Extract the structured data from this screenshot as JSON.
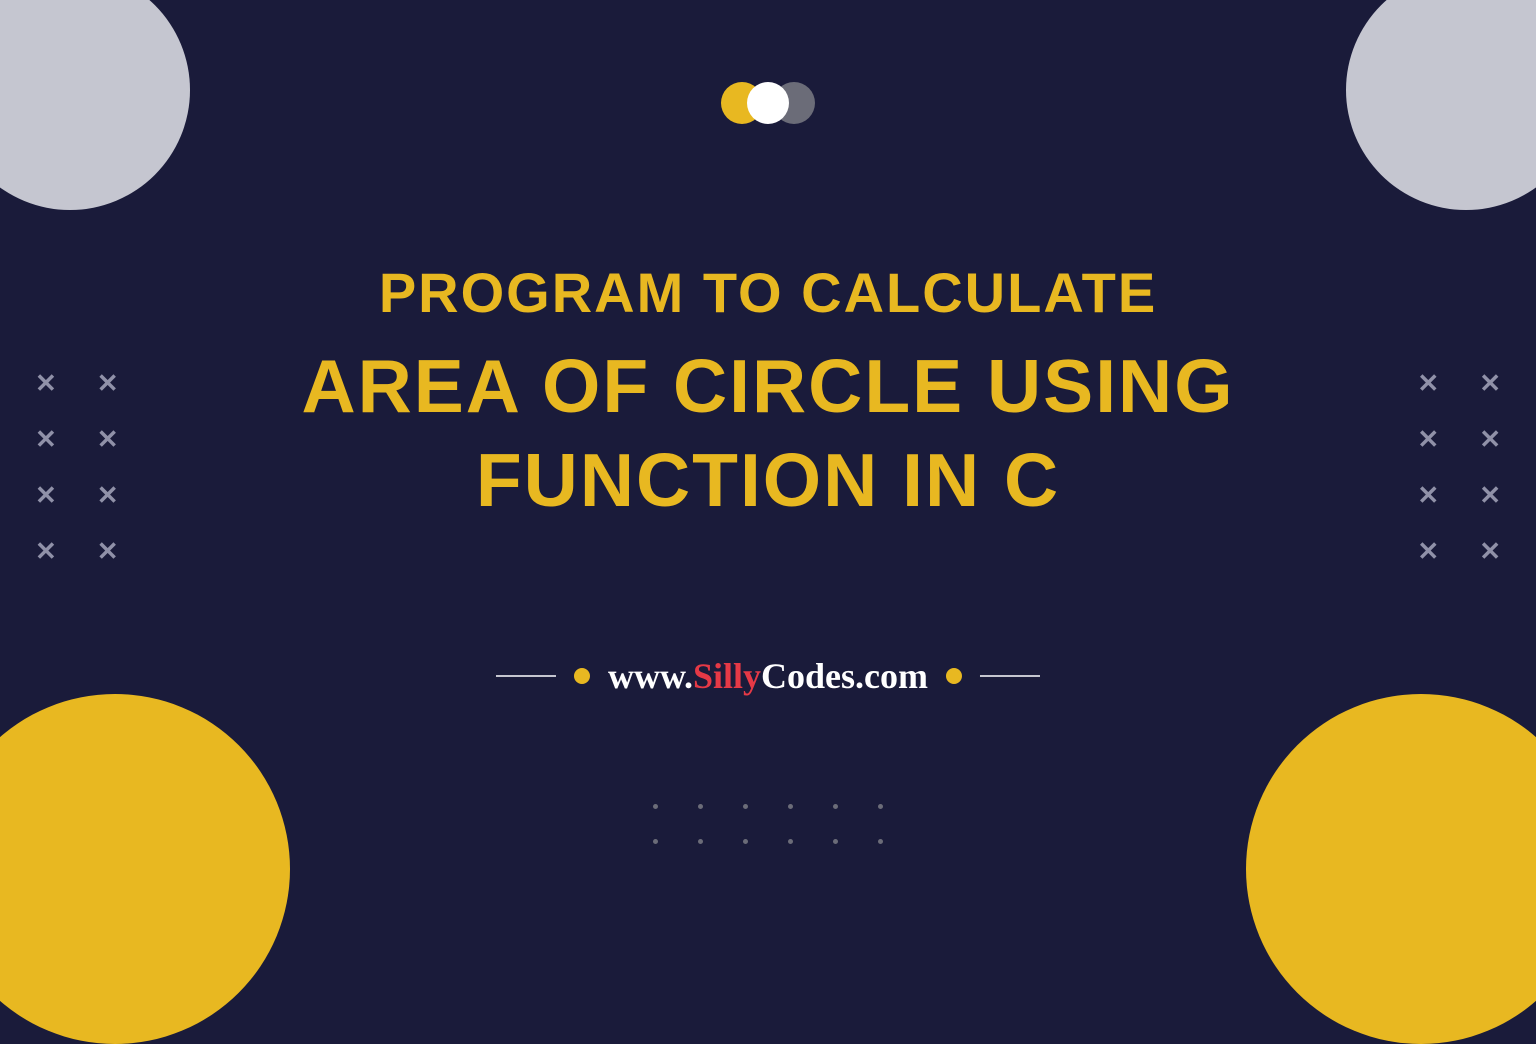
{
  "title": {
    "line1": "Program to Calculate",
    "line2": "Area of Circle Using",
    "line3": "Function in C"
  },
  "url": {
    "prefix": "www.",
    "brand_part1": "Silly",
    "brand_part2": "Codes",
    "suffix": ".com"
  },
  "colors": {
    "background": "#1a1b3a",
    "accent_yellow": "#e8b821",
    "accent_red": "#e63946",
    "grey": "#c5c6d0",
    "white": "#ffffff"
  }
}
